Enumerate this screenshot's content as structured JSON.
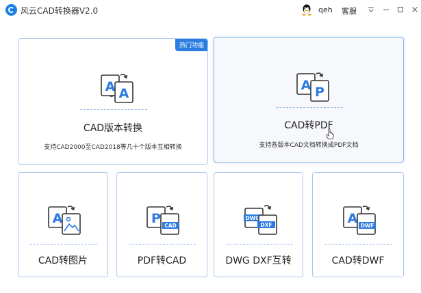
{
  "window": {
    "title": "风云CAD转换器V2.0",
    "user_name": "qeh",
    "service_label": "客服"
  },
  "cards": {
    "cad_version": {
      "title": "CAD版本转换",
      "description": "支持CAD2000至CAD2018等几十个版本互相转换",
      "badge": "热门功能",
      "icon": "cad-version-convert-icon"
    },
    "cad_to_pdf": {
      "title": "CAD转PDF",
      "description": "支持各版本CAD文档转换成PDF文档",
      "icon": "cad-to-pdf-icon"
    },
    "cad_to_image": {
      "title": "CAD转图片",
      "icon": "cad-to-image-icon"
    },
    "pdf_to_cad": {
      "title": "PDF转CAD",
      "icon": "pdf-to-cad-icon",
      "icon_label": "CAD"
    },
    "dwg_dxf": {
      "title": "DWG DXF互转",
      "icon": "dwg-dxf-icon",
      "icon_labels": [
        "DWG",
        "DXF"
      ]
    },
    "cad_to_dwf": {
      "title": "CAD转DWF",
      "icon": "cad-to-dwf-icon",
      "icon_label": "DWF"
    }
  },
  "colors": {
    "accent": "#2a7de1",
    "card_border": "#a9c8ef",
    "icon_blue": "#2d7ae0"
  }
}
